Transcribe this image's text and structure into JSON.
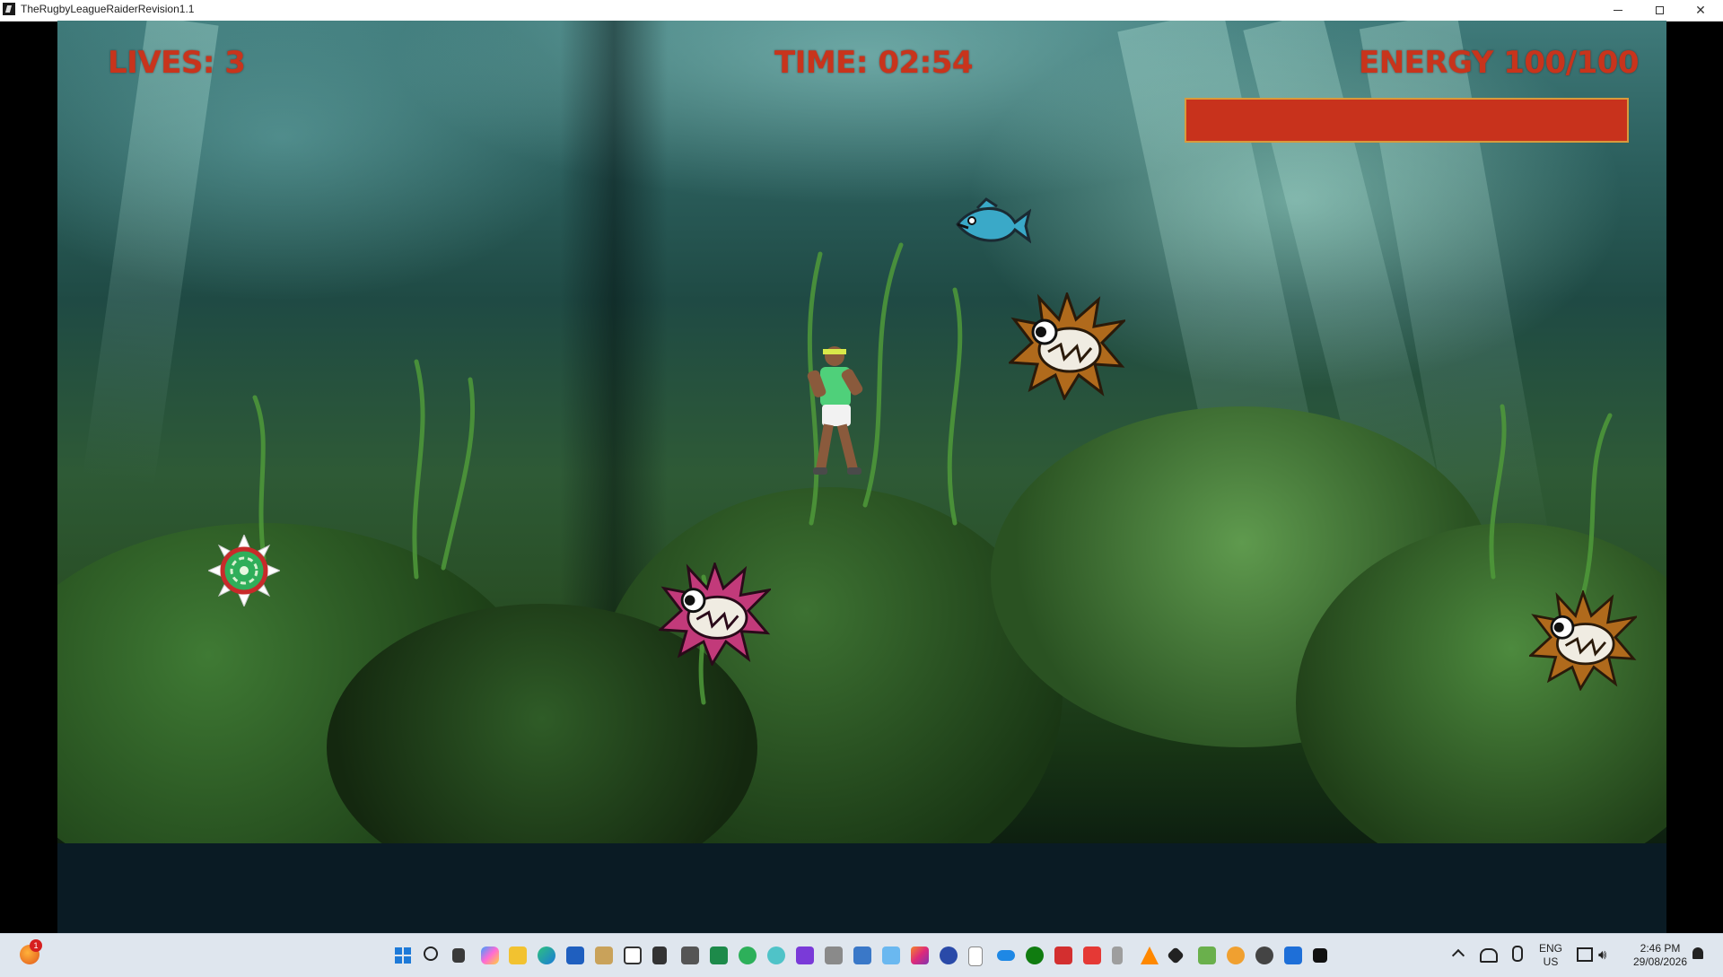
{
  "window": {
    "title": "TheRugbyLeagueRaiderRevision1.1"
  },
  "hud": {
    "lives_text": "LIVES: 3",
    "lives": 3,
    "time_text": "TIME: 02:54",
    "energy_text": "ENERGY 100/100",
    "energy_fraction": 1.0,
    "hud_color": "#c8341c",
    "energy_bar_color": "#c8321c",
    "energy_bar_border": "#d89a3c"
  },
  "sprites": [
    {
      "kind": "player-rugby-raider",
      "color": "#4fd07a"
    },
    {
      "kind": "blue-fish",
      "color": "#3aa9c8"
    },
    {
      "kind": "pufferfish",
      "color": "#b06a1c"
    },
    {
      "kind": "pufferfish",
      "color": "#c23a7a"
    },
    {
      "kind": "pufferfish",
      "color": "#b06a1c"
    },
    {
      "kind": "sea-mine",
      "color": "#2fae5a"
    }
  ],
  "taskbar": {
    "notification_count": "1",
    "language_line1": "ENG",
    "language_line2": "US",
    "clock_time": "2:46 PM",
    "clock_date": "29/08/2026",
    "pinned_icons": [
      "start-icon",
      "search-icon",
      "task-view-icon",
      "copilot-icon",
      "file-explorer-icon",
      "edge-icon",
      "store-icon",
      "app-icon",
      "app-icon",
      "app-icon",
      "camera-icon",
      "app-icon",
      "app-icon",
      "app-icon",
      "app-icon",
      "app-icon",
      "app-icon",
      "app-icon",
      "app-icon",
      "app-icon",
      "app-icon",
      "onedrive-icon",
      "xbox-icon",
      "app-icon",
      "app-icon",
      "app-icon",
      "vlc-icon",
      "app-icon",
      "app-icon",
      "app-icon",
      "app-icon",
      "app-icon",
      "game-window-icon"
    ],
    "tray_icons": [
      "chevron-up-icon",
      "network-off-icon",
      "microphone-icon",
      "display-icon",
      "volume-icon",
      "bell-icon"
    ]
  }
}
